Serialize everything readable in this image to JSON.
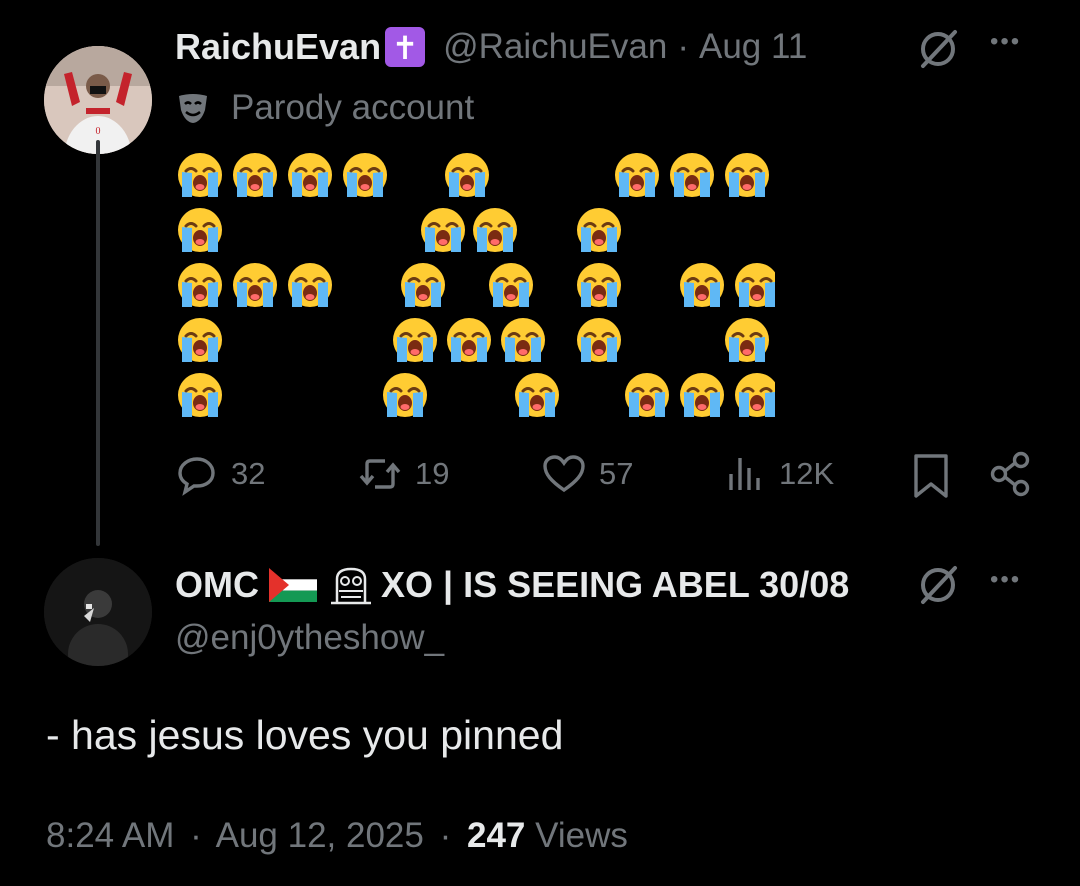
{
  "original_post": {
    "display_name": "RaichuEvan",
    "badge_glyph": "✝",
    "handle": "@RaichuEvan",
    "separator": "·",
    "date": "Aug 11",
    "label": "Parody account",
    "grok_icon": "slashed-circle-icon",
    "more_glyph": "•••",
    "emoji_art": {
      "emoji_name": "loudly-crying-face",
      "grid_rows": [
        "1111   1     111",
        "1      11   1",
        "111   1  1  1  11",
        "1     111   1   1",
        "1    1   1   111"
      ]
    },
    "actions": {
      "replies": "32",
      "reposts": "19",
      "likes": "57",
      "views": "12K"
    }
  },
  "reply_post": {
    "display_name": "OMC",
    "flag_name": "palestine-flag",
    "owl_name": "owl-icon",
    "name_suffix": "XO | IS SEEING ABEL 30/08",
    "handle": "@enj0ytheshow_",
    "more_glyph": "•••",
    "text": "- has jesus loves you pinned",
    "time": "8:24 AM",
    "date": "Aug 12, 2025",
    "separator": "·",
    "views_count": "247",
    "views_label": "Views"
  },
  "colors": {
    "background": "#000000",
    "text": "#e7e9ea",
    "muted": "#71767b",
    "badge": "#a259e6",
    "emoji_yellow": "#ffcc33",
    "tear_blue": "#5fb8f5"
  }
}
